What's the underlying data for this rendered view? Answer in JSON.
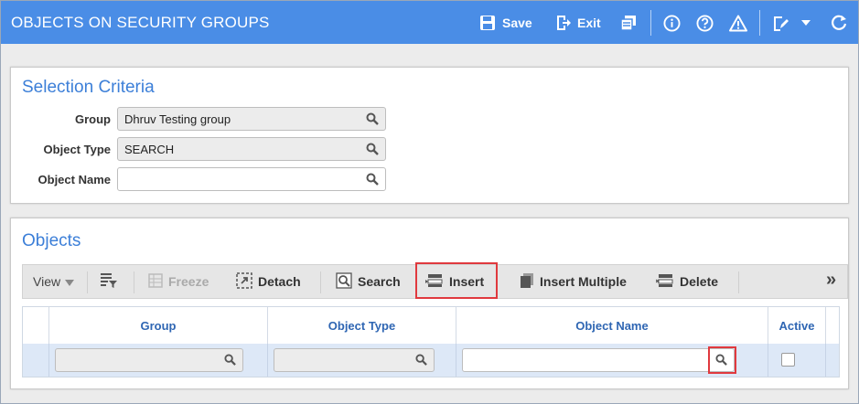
{
  "header": {
    "title": "OBJECTS ON SECURITY GROUPS",
    "save_label": "Save",
    "exit_label": "Exit",
    "icons": [
      "save-icon",
      "exit-icon",
      "copy-icon",
      "info-icon",
      "help-icon",
      "warning-icon",
      "edit-icon",
      "dropdown-icon",
      "refresh-icon"
    ],
    "background": "#4a8de6"
  },
  "selection": {
    "title": "Selection Criteria",
    "fields": [
      {
        "label": "Group",
        "value": "Dhruv Testing group"
      },
      {
        "label": "Object Type",
        "value": "SEARCH"
      },
      {
        "label": "Object Name",
        "value": ""
      }
    ]
  },
  "objects": {
    "title": "Objects",
    "toolbar": {
      "view_label": "View",
      "freeze_label": "Freeze",
      "detach_label": "Detach",
      "search_label": "Search",
      "insert_label": "Insert",
      "insert_multiple_label": "Insert Multiple",
      "delete_label": "Delete",
      "more_label": "»"
    },
    "columns": [
      "Group",
      "Object Type",
      "Object Name",
      "Active"
    ],
    "rows": [
      {
        "group": "",
        "object_type": "",
        "object_name": "",
        "active": false
      }
    ]
  }
}
